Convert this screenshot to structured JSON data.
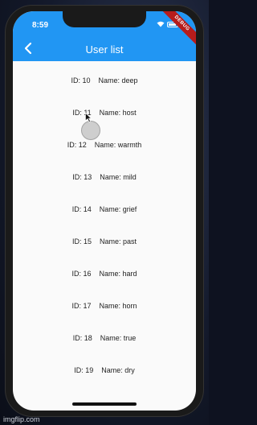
{
  "status_bar": {
    "time": "8:59"
  },
  "app_bar": {
    "title": "User list",
    "back_icon": "chevron-left-icon",
    "color": "#2196f3"
  },
  "debug_banner": "DEBUG",
  "users": [
    {
      "id": "ID: 10",
      "name": "Name: deep"
    },
    {
      "id": "ID: 11",
      "name": "Name: host"
    },
    {
      "id": "ID: 12",
      "name": "Name: warmth"
    },
    {
      "id": "ID: 13",
      "name": "Name: mild"
    },
    {
      "id": "ID: 14",
      "name": "Name: grief"
    },
    {
      "id": "ID: 15",
      "name": "Name: past"
    },
    {
      "id": "ID: 16",
      "name": "Name: hard"
    },
    {
      "id": "ID: 17",
      "name": "Name: horn"
    },
    {
      "id": "ID: 18",
      "name": "Name: true"
    },
    {
      "id": "ID: 19",
      "name": "Name: dry"
    }
  ],
  "watermark": "imgflip.com"
}
